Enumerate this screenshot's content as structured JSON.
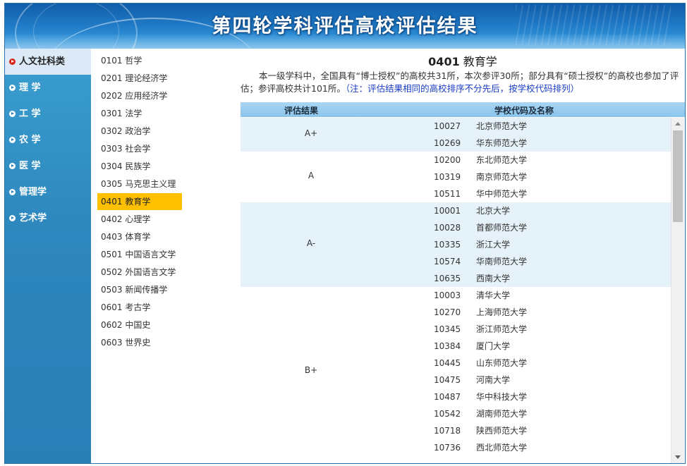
{
  "header": {
    "title": "第四轮学科评估高校评估结果"
  },
  "categories": [
    {
      "label": "人文社科类",
      "active": true
    },
    {
      "label": "理 学",
      "active": false
    },
    {
      "label": "工 学",
      "active": false
    },
    {
      "label": "农 学",
      "active": false
    },
    {
      "label": "医 学",
      "active": false
    },
    {
      "label": "管理学",
      "active": false
    },
    {
      "label": "艺术学",
      "active": false
    }
  ],
  "subjects": [
    {
      "label": "0101 哲学"
    },
    {
      "label": "0201 理论经济学"
    },
    {
      "label": "0202 应用经济学"
    },
    {
      "label": "0301 法学"
    },
    {
      "label": "0302 政治学"
    },
    {
      "label": "0303 社会学"
    },
    {
      "label": "0304 民族学"
    },
    {
      "label": "0305 马克思主义理论"
    },
    {
      "label": "0401 教育学",
      "active": true
    },
    {
      "label": "0402 心理学"
    },
    {
      "label": "0403 体育学"
    },
    {
      "label": "0501 中国语言文学"
    },
    {
      "label": "0502 外国语言文学"
    },
    {
      "label": "0503 新闻传播学"
    },
    {
      "label": "0601 考古学"
    },
    {
      "label": "0602 中国史"
    },
    {
      "label": "0603 世界史"
    }
  ],
  "main": {
    "code": "0401",
    "subject": "教育学",
    "description": "本一级学科中，全国具有“博士授权”的高校共31所，本次参评30所；部分具有“硕士授权”的高校也参加了评估；参评高校共计101所。",
    "note": "（注：评估结果相同的高校排序不分先后，按学校代码排列）",
    "columns": {
      "grade": "评估结果",
      "school": "学校代码及名称"
    },
    "groups": [
      {
        "grade": "A+",
        "shade": true,
        "rows": [
          {
            "code": "10027",
            "name": "北京师范大学"
          },
          {
            "code": "10269",
            "name": "华东师范大学"
          }
        ]
      },
      {
        "grade": "A",
        "shade": false,
        "rows": [
          {
            "code": "10200",
            "name": "东北师范大学"
          },
          {
            "code": "10319",
            "name": "南京师范大学"
          },
          {
            "code": "10511",
            "name": "华中师范大学"
          }
        ]
      },
      {
        "grade": "A-",
        "shade": true,
        "rows": [
          {
            "code": "10001",
            "name": "北京大学"
          },
          {
            "code": "10028",
            "name": "首都师范大学"
          },
          {
            "code": "10335",
            "name": "浙江大学"
          },
          {
            "code": "10574",
            "name": "华南师范大学"
          },
          {
            "code": "10635",
            "name": "西南大学"
          }
        ]
      },
      {
        "grade": "B+",
        "shade": false,
        "rows": [
          {
            "code": "10003",
            "name": "清华大学"
          },
          {
            "code": "10270",
            "name": "上海师范大学"
          },
          {
            "code": "10345",
            "name": "浙江师范大学"
          },
          {
            "code": "10384",
            "name": "厦门大学"
          },
          {
            "code": "10445",
            "name": "山东师范大学"
          },
          {
            "code": "10475",
            "name": "河南大学"
          },
          {
            "code": "10487",
            "name": "华中科技大学"
          },
          {
            "code": "10542",
            "name": "湖南师范大学"
          },
          {
            "code": "10718",
            "name": "陕西师范大学"
          },
          {
            "code": "10736",
            "name": "西北师范大学"
          }
        ]
      }
    ]
  },
  "colors": {
    "banner": "#1f78c4",
    "category_bg": "#2d86bd",
    "active_subject": "#ffc000",
    "row_shade": "#e6f2f9",
    "header_row": "#a9d5f2",
    "note": "#1a3cc4"
  }
}
